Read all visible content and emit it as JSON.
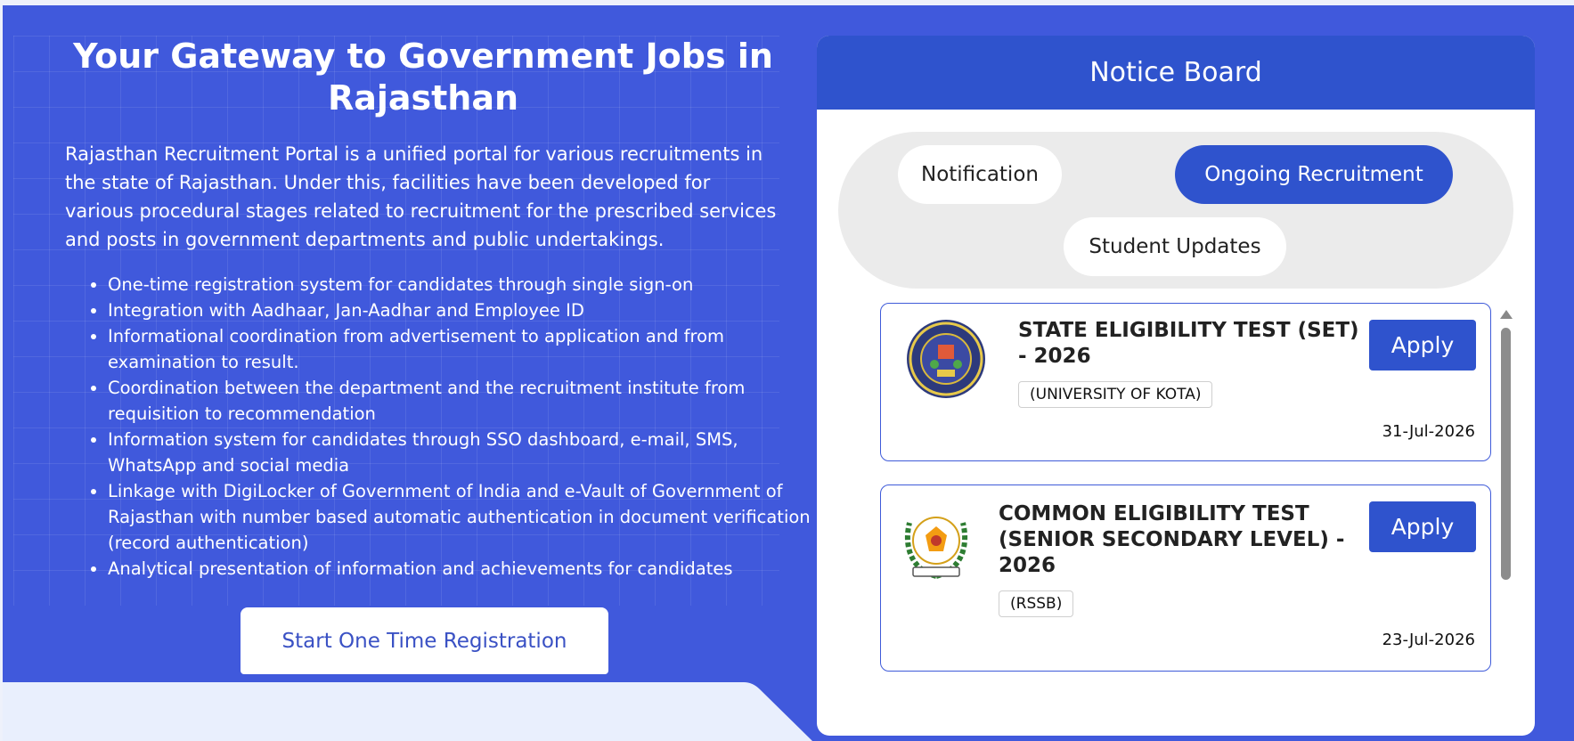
{
  "hero": {
    "title": "Your Gateway to Government Jobs in Rajasthan",
    "intro": "Rajasthan Recruitment Portal is a unified portal for various recruitments in the state of Rajasthan. Under this, facilities have been developed for various procedural stages related to recruitment for the prescribed services and posts in government departments and public undertakings.",
    "bullets": [
      "One-time registration system for candidates through single sign-on",
      "Integration with Aadhaar, Jan-Aadhar and Employee ID",
      "Informational coordination from advertisement to application and from examination to result.",
      "Coordination between the department and the recruitment institute from requisition to recommendation",
      "Information system for candidates through SSO dashboard, e-mail, SMS, WhatsApp and social media",
      "Linkage with DigiLocker of Government of India and e-Vault of Government of Rajasthan with number based automatic authentication in document verification (record authentication)",
      "Analytical presentation of information and achievements for candidates"
    ],
    "cta_label": "Start One Time Registration"
  },
  "notice_board": {
    "title": "Notice Board",
    "tabs": [
      {
        "label": "Notification",
        "active": false
      },
      {
        "label": "Ongoing Recruitment",
        "active": true
      },
      {
        "label": "Student Updates",
        "active": false
      }
    ],
    "items": [
      {
        "title": "STATE ELIGIBILITY TEST (SET) - 2026",
        "org": "(UNIVERSITY OF KOTA)",
        "date": "31-Jul-2026",
        "apply_label": "Apply",
        "logo": "university-of-kota-seal"
      },
      {
        "title": "COMMON ELIGIBILITY TEST (SENIOR SECONDARY LEVEL) - 2026",
        "org": "(RSSB)",
        "date": "23-Jul-2026",
        "apply_label": "Apply",
        "logo": "rssb-emblem"
      }
    ]
  },
  "colors": {
    "hero_bg": "#4059dc",
    "accent": "#2f53cd",
    "pill_bar": "#ebebeb",
    "page_bottom": "#e9effd"
  }
}
